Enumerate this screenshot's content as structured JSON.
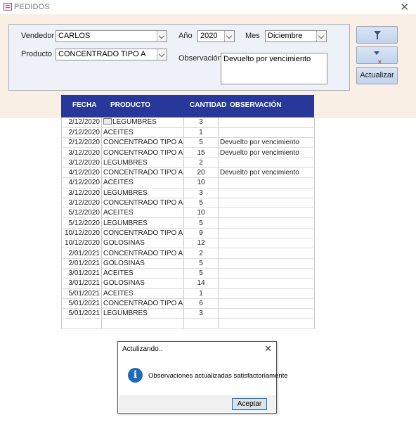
{
  "window": {
    "title": "PEDIDOS"
  },
  "filters": {
    "vendedor_label": "Vendedor",
    "vendedor_value": "CARLOS",
    "anio_label": "Año",
    "anio_value": "2020",
    "mes_label": "Mes",
    "mes_value": "Diciembre",
    "producto_label": "Producto",
    "producto_value": "CONCENTRADO TIPO A",
    "observacion_label": "Observación",
    "observacion_value": "Devuelto por vencimiento"
  },
  "buttons": {
    "actualizar_label": "Actualizar"
  },
  "grid": {
    "headers": [
      "FECHA",
      "PRODUCTO",
      "CANTIDAD",
      "OBSERVACIÓN"
    ],
    "rows": [
      [
        "2/12/2020",
        "LEGUMBRES",
        "3",
        ""
      ],
      [
        "2/12/2020",
        "ACEITES",
        "1",
        ""
      ],
      [
        "2/12/2020",
        "CONCENTRADO TIPO A",
        "5",
        "Devuelto por vencimiento"
      ],
      [
        "3/12/2020",
        "CONCENTRADO TIPO A",
        "15",
        "Devuelto por vencimiento"
      ],
      [
        "3/12/2020",
        "LEGUMBRES",
        "2",
        ""
      ],
      [
        "4/12/2020",
        "CONCENTRADO TIPO A",
        "20",
        "Devuelto por vencimiento"
      ],
      [
        "4/12/2020",
        "ACEITES",
        "10",
        ""
      ],
      [
        "3/12/2020",
        "LEGUMBRES",
        "3",
        ""
      ],
      [
        "3/12/2020",
        "CONCENTRADO TIPO A",
        "5",
        ""
      ],
      [
        "5/12/2020",
        "ACEITES",
        "10",
        ""
      ],
      [
        "5/12/2020",
        "LEGUMBRES",
        "5",
        ""
      ],
      [
        "10/12/2020",
        "CONCENTRADO TIPO A",
        "9",
        ""
      ],
      [
        "10/12/2020",
        "GOLOSINAS",
        "12",
        ""
      ],
      [
        "2/01/2021",
        "CONCENTRADO TIPO A",
        "2",
        ""
      ],
      [
        "2/01/2021",
        "GOLOSINAS",
        "5",
        ""
      ],
      [
        "3/01/2021",
        "ACEITES",
        "5",
        ""
      ],
      [
        "3/01/2021",
        "GOLOSINAS",
        "14",
        ""
      ],
      [
        "5/01/2021",
        "ACEITES",
        "1",
        ""
      ],
      [
        "5/01/2021",
        "CONCENTRADO TIPO A",
        "6",
        ""
      ],
      [
        "5/01/2021",
        "LEGUMBRES",
        "3",
        ""
      ],
      [
        "",
        "",
        "",
        ""
      ]
    ]
  },
  "dialog": {
    "title": "Actulizando..",
    "message": "Observaciones actualizadas satisfactoriamente",
    "ok_label": "Aceptar"
  }
}
